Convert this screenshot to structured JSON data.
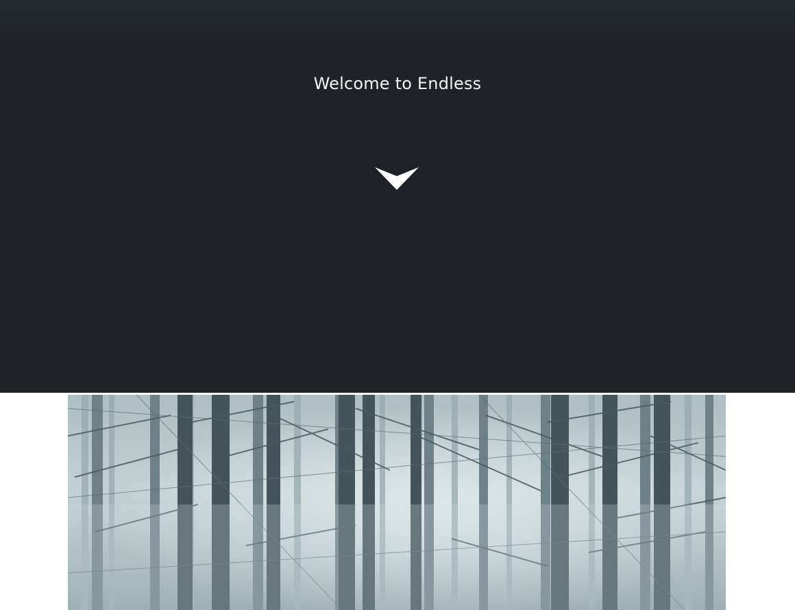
{
  "hero": {
    "title": "Welcome to Endless",
    "background_color": "#1e2226",
    "text_color": "#f2f4f6",
    "scroll_icon": "chevron-down-icon"
  },
  "photo": {
    "subject": "misty-forest-image",
    "palette": [
      "#c9d6da",
      "#93a6ac",
      "#4f5e63",
      "#2f3a3e"
    ]
  }
}
